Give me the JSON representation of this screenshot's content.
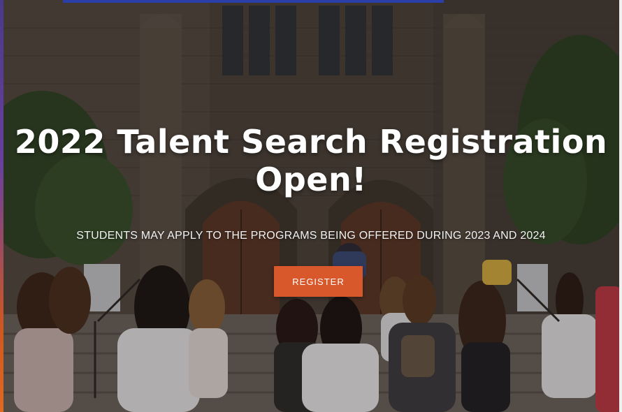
{
  "hero": {
    "headline_line1": "2022 Talent Search Registration",
    "headline_line2": "Open!",
    "subheadline": "STUDENTS MAY APPLY TO THE PROGRAMS BEING OFFERED DURING 2023 AND 2024",
    "register_label": "REGISTER"
  },
  "colors": {
    "button": "#d9582b",
    "accent_top": "#2a3fa8",
    "text": "#ffffff"
  }
}
